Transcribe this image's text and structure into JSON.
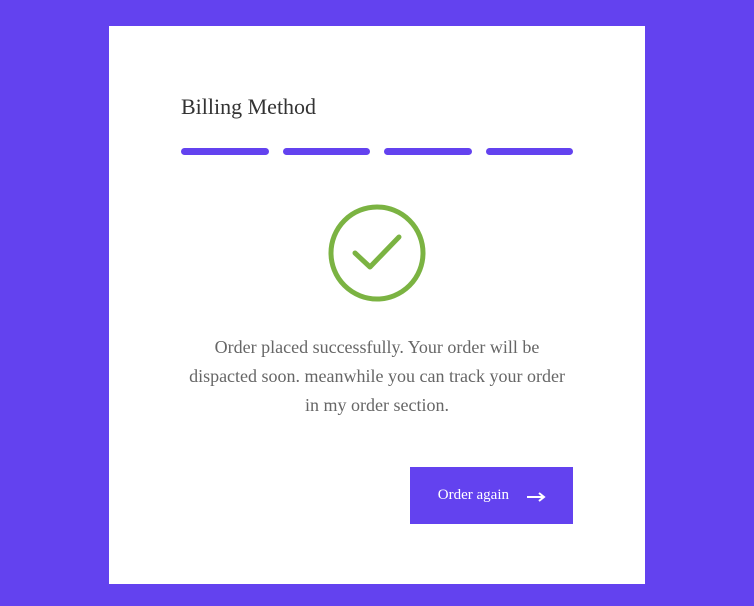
{
  "title": "Billing Method",
  "progress_steps": 4,
  "success_message": "Order placed successfully. Your order will be dispacted soon. meanwhile you can track your order in my order section.",
  "button_label": "Order again",
  "colors": {
    "accent": "#6342ef",
    "success": "#7bb342"
  }
}
